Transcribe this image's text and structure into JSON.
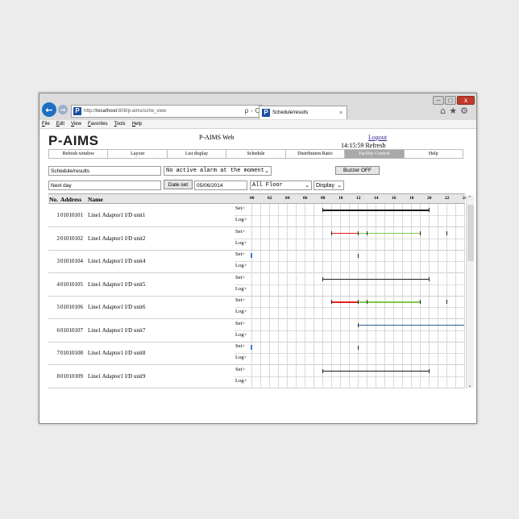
{
  "browser": {
    "address_prefix": "http://",
    "address_host": "localhost",
    "address_rest": ":808/p-aims/sche_view",
    "address_tools": "ρ - C",
    "tab_title": "Schedule/results",
    "tab_close": "×",
    "favicon": "P",
    "back_icon": "←",
    "forward_icon": "→",
    "toolbar_icons": "⌂★⚙",
    "window_min": "–",
    "window_max": "□",
    "window_close": "x",
    "menu": [
      "File",
      "Edit",
      "View",
      "Favorites",
      "Tools",
      "Help"
    ]
  },
  "app": {
    "logo": "P-AIMS",
    "title": "P-AIMS Web",
    "logout": "Logout",
    "clock": "14:15:59 Refresh",
    "nav": [
      {
        "label": "Refresh window",
        "active": false
      },
      {
        "label": "Layout",
        "active": false
      },
      {
        "label": "List display",
        "active": false
      },
      {
        "label": "Schedule",
        "active": false
      },
      {
        "label": "Distribution Ratio",
        "active": false
      },
      {
        "label": "Facility Control",
        "active": true
      },
      {
        "label": "Help",
        "active": false
      }
    ]
  },
  "controls": {
    "page_name": "Schedule/results",
    "alarm_select": "No active alarm at the moment",
    "buzzer_button": "Buzzer OFF",
    "day_field": "Next day",
    "date_set_button": "Date set",
    "date_value": "05/06/2014",
    "floor_select": "All Floor",
    "display_select": "Display"
  },
  "table": {
    "col_no": "No.",
    "col_address": "Address",
    "col_name": "Name",
    "hours": [
      "00",
      "02",
      "04",
      "06",
      "08",
      "10",
      "12",
      "14",
      "16",
      "18",
      "20",
      "22",
      "24"
    ],
    "set_label": "Set>",
    "log_label": "Log>",
    "rows": [
      {
        "no": "1",
        "address": "01010101",
        "name": "Line1 Adaptor1 I/D unit1",
        "pattern": "black"
      },
      {
        "no": "2",
        "address": "01010102",
        "name": "Line1 Adaptor1 I/D unit2",
        "pattern": "redgreen"
      },
      {
        "no": "3",
        "address": "01010104",
        "name": "Line1 Adaptor1 I/D unit4",
        "pattern": "tick"
      },
      {
        "no": "4",
        "address": "01010105",
        "name": "Line1 Adaptor1 I/D unit5",
        "pattern": "black"
      },
      {
        "no": "5",
        "address": "01010106",
        "name": "Line1 Adaptor1 I/D unit6",
        "pattern": "redgreen"
      },
      {
        "no": "6",
        "address": "01010107",
        "name": "Line1 Adaptor1 I/D unit7",
        "pattern": "blue"
      },
      {
        "no": "7",
        "address": "01010108",
        "name": "Line1 Adaptor1 I/D unit8",
        "pattern": "tick"
      },
      {
        "no": "8",
        "address": "01010109",
        "name": "Line1 Adaptor1 I/D unit9",
        "pattern": "black"
      },
      {
        "no": "9",
        "address": "01010110",
        "name": "Line1 Adaptor1 I/D unit10",
        "pattern": "redgreen"
      },
      {
        "no": "",
        "address": "",
        "name": "",
        "pattern": "tick"
      }
    ]
  },
  "schedule_hours": {
    "black": [
      [
        8,
        20
      ]
    ],
    "redgreen_red": [
      [
        9,
        12
      ]
    ],
    "redgreen_green": [
      [
        12,
        19
      ]
    ],
    "redgreen_ticks": [
      9,
      12,
      13,
      19,
      22
    ],
    "tick": [
      12
    ],
    "blue": [
      [
        12,
        24
      ]
    ]
  },
  "colors": {
    "black": "#1a1a1a",
    "red": "#e02020",
    "green": "#7ec84a",
    "blue": "#2d5b8c",
    "start_marker": "#3a7bd5"
  }
}
